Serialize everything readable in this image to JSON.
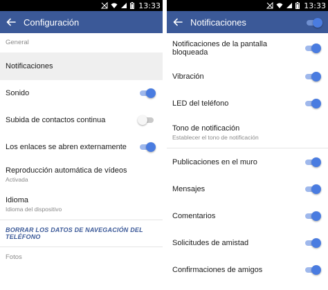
{
  "status_time": "13:33",
  "left": {
    "title": "Configuración",
    "section_general": "General",
    "items": [
      {
        "label": "Notificaciones"
      },
      {
        "label": "Sonido",
        "toggle": true
      },
      {
        "label": "Subida de contactos continua",
        "toggle": false
      },
      {
        "label": "Los enlaces se abren externamente",
        "toggle": true
      },
      {
        "label": "Reproducción automática de vídeos",
        "sub": "Activada"
      },
      {
        "label": "Idioma",
        "sub": "Idioma del dispositivo"
      }
    ],
    "clear_data": "BORRAR LOS DATOS DE NAVEGACIÓN DEL TELÉFONO",
    "section_fotos": "Fotos"
  },
  "right": {
    "title": "Notificaciones",
    "master_toggle": true,
    "items": [
      {
        "label": "Notificaciones de la pantalla bloqueada",
        "toggle": true
      },
      {
        "label": "Vibración",
        "toggle": true
      },
      {
        "label": "LED del teléfono",
        "toggle": true
      },
      {
        "label": "Tono de notificación",
        "sub": "Establecer el tono de notificación"
      },
      {
        "label": "Publicaciones en el muro",
        "toggle": true
      },
      {
        "label": "Mensajes",
        "toggle": true
      },
      {
        "label": "Comentarios",
        "toggle": true
      },
      {
        "label": "Solicitudes de amistad",
        "toggle": true
      },
      {
        "label": "Confirmaciones de amigos",
        "toggle": true
      }
    ]
  },
  "icons": {
    "status": [
      "no-signal-icon",
      "wifi-icon",
      "signal-icon",
      "battery-icon"
    ],
    "appbar": "arrow-back-icon"
  },
  "colors": {
    "appbar": "#3b5998",
    "toggle_on": "#4a7ce0",
    "link": "#3b5998"
  }
}
